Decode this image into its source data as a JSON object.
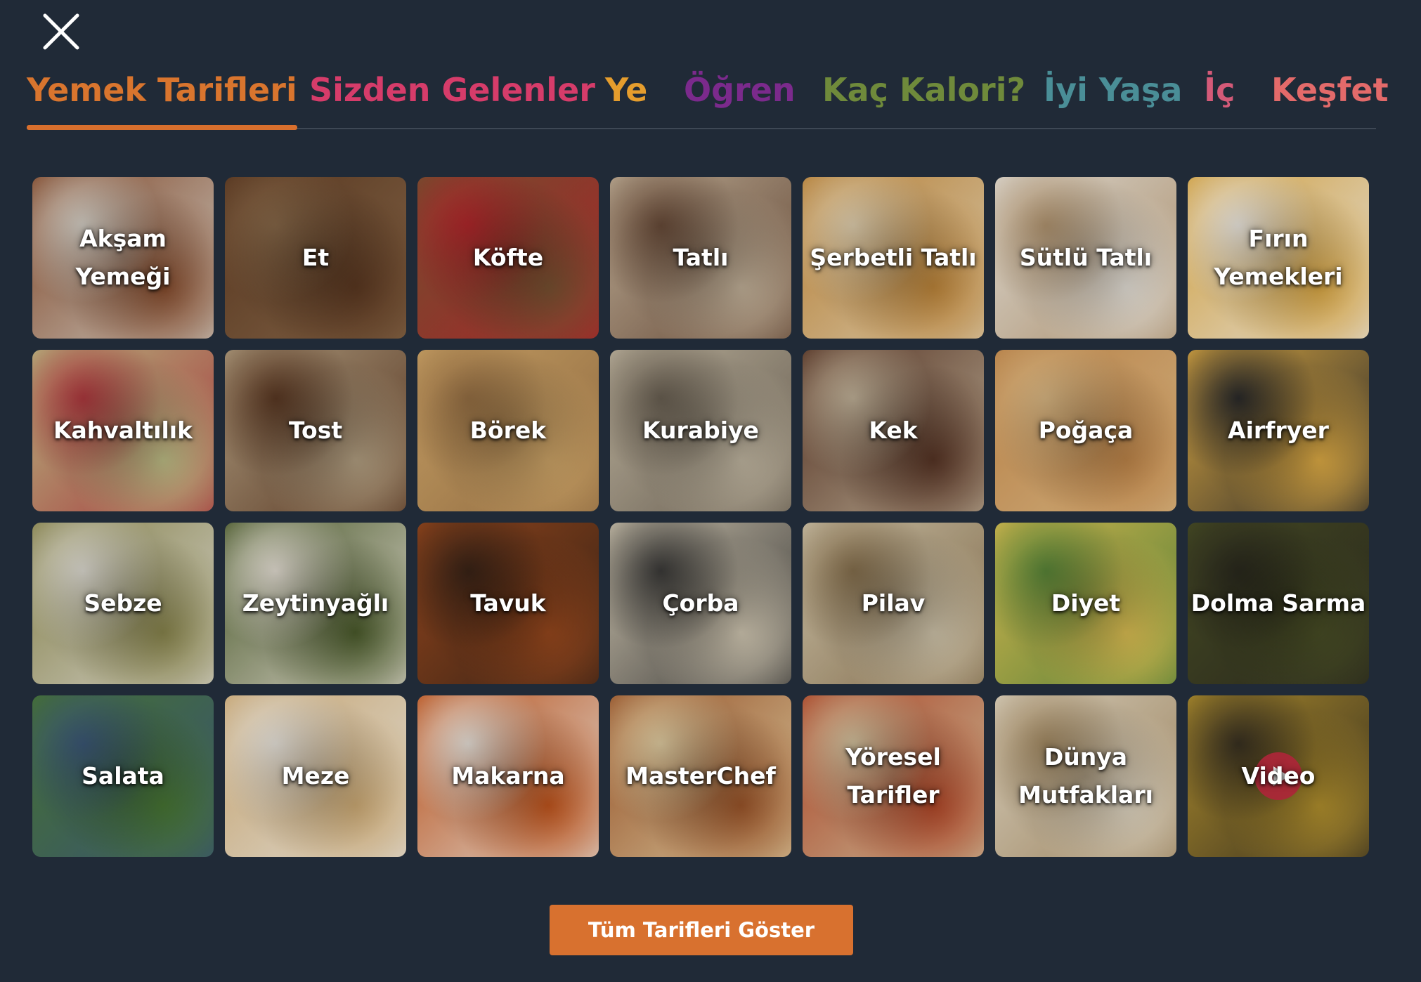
{
  "close": {
    "icon": "close-icon",
    "color": "#ffffff"
  },
  "tabs": [
    {
      "label": "Yemek Tarifleri",
      "color": "#d9752e",
      "active": true
    },
    {
      "label": "Sizden Gelenler",
      "color": "#d63c6a",
      "active": false
    },
    {
      "label": "Ye",
      "color": "#e59d2d",
      "active": false
    },
    {
      "label": "Öğren",
      "color": "#7b2a8c",
      "active": false
    },
    {
      "label": "Kaç Kalori?",
      "color": "#6f8a3b",
      "active": false
    },
    {
      "label": "İyi Yaşa",
      "color": "#4a8e97",
      "active": false
    },
    {
      "label": "İç",
      "color": "#d45a78",
      "active": false
    },
    {
      "label": "Keşfet",
      "color": "#e36a6a",
      "active": false
    }
  ],
  "categories": [
    {
      "label": "Akşam Yemeği",
      "c1": "#8a4e2e",
      "c2": "#dcd6cc"
    },
    {
      "label": "Et",
      "c1": "#5e3a22",
      "c2": "#8a6a4a"
    },
    {
      "label": "Köfte",
      "c1": "#7b5332",
      "c2": "#b5282c"
    },
    {
      "label": "Tatlı",
      "c1": "#c9b79e",
      "c2": "#6b4d3a"
    },
    {
      "label": "Şerbetli Tatlı",
      "c1": "#c48a3c",
      "c2": "#e8d6b4"
    },
    {
      "label": "Sütlü Tatlı",
      "c1": "#ede8df",
      "c2": "#b89a74"
    },
    {
      "label": "Fırın Yemekleri",
      "c1": "#e1ad46",
      "c2": "#f4efe6"
    },
    {
      "label": "Kahvaltılık",
      "c1": "#c4c48a",
      "c2": "#b43a40"
    },
    {
      "label": "Tost",
      "c1": "#b9a586",
      "c2": "#5d3a24"
    },
    {
      "label": "Börek",
      "c1": "#d3a96a",
      "c2": "#9b7346"
    },
    {
      "label": "Kurabiye",
      "c1": "#c7bca6",
      "c2": "#6d6355"
    },
    {
      "label": "Kek",
      "c1": "#5a3626",
      "c2": "#c7b79d"
    },
    {
      "label": "Poğaça",
      "c1": "#c58a4c",
      "c2": "#e1bd87"
    },
    {
      "label": "Airfryer",
      "c1": "#e7b247",
      "c2": "#2b2b2b"
    },
    {
      "label": "Sebze",
      "c1": "#8e8a4f",
      "c2": "#e5e2d8"
    },
    {
      "label": "Zeytinyağlı",
      "c1": "#4e5f2d",
      "c2": "#ece6da"
    },
    {
      "label": "Tavuk",
      "c1": "#9c4a1e",
      "c2": "#3b2417"
    },
    {
      "label": "Çorba",
      "c1": "#d8ceb8",
      "c2": "#3d3c3a"
    },
    {
      "label": "Pilav",
      "c1": "#d7cbb0",
      "c2": "#8a7350"
    },
    {
      "label": "Diyet",
      "c1": "#e2c455",
      "c2": "#5c8a3a"
    },
    {
      "label": "Dolma Sarma",
      "c1": "#4a4f26",
      "c2": "#2b2a1e"
    },
    {
      "label": "Salata",
      "c1": "#4a7a35",
      "c2": "#3d5a7a"
    },
    {
      "label": "Meze",
      "c1": "#d6b27a",
      "c2": "#f0ebe2"
    },
    {
      "label": "Makarna",
      "c1": "#c8581e",
      "c2": "#f0e8df"
    },
    {
      "label": "MasterChef",
      "c1": "#a1582b",
      "c2": "#e8d3a6"
    },
    {
      "label": "Yöresel\nTarifler",
      "c1": "#b84a2a",
      "c2": "#d9c7a2"
    },
    {
      "label": "Dünya\nMutfakları",
      "c1": "#e6dcc8",
      "c2": "#a88e66"
    },
    {
      "label": "Video",
      "c1": "#b9962f",
      "c2": "#3a3222",
      "video": true
    }
  ],
  "show_all_button": {
    "label": "Tüm Tarifleri Göster",
    "color": "#d8712f"
  }
}
